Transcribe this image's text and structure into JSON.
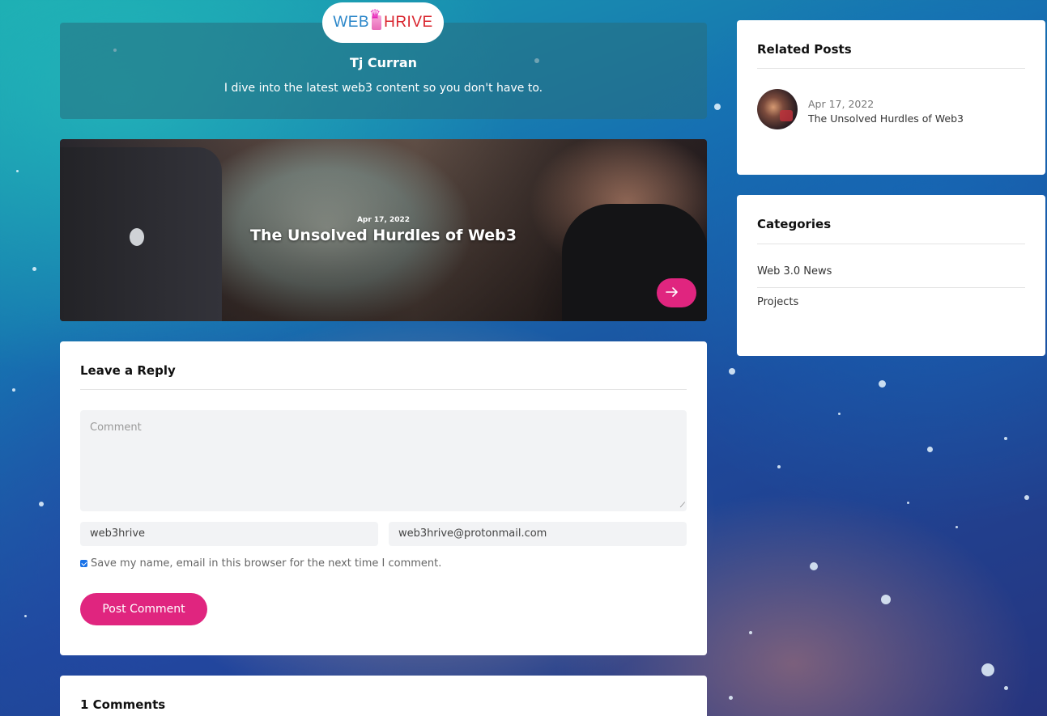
{
  "logo": {
    "word1": "WEB",
    "word2": "HRIVE"
  },
  "author": {
    "name": "Tj Curran",
    "bio": "I dive into the latest web3 content so you don't have to."
  },
  "featured_post": {
    "date": "Apr 17, 2022",
    "title": "The Unsolved Hurdles of Web3",
    "arrow_icon": "arrow-right-icon"
  },
  "reply_form": {
    "heading": "Leave a Reply",
    "comment_placeholder": "Comment",
    "name_value": "web3hrive",
    "email_value": "web3hrive@protonmail.com",
    "save_label": "Save my name, email in this browser for the next time I comment.",
    "save_checked": true,
    "submit_label": "Post Comment"
  },
  "comments_section": {
    "heading": "1 Comments"
  },
  "sidebar": {
    "related": {
      "heading": "Related Posts",
      "items": [
        {
          "date": "Apr 17, 2022",
          "title": "The Unsolved Hurdles of Web3"
        }
      ]
    },
    "categories": {
      "heading": "Categories",
      "items": [
        "Web 3.0 News",
        "Projects"
      ]
    }
  },
  "colors": {
    "accent": "#e0257f",
    "card": "#ffffff"
  }
}
